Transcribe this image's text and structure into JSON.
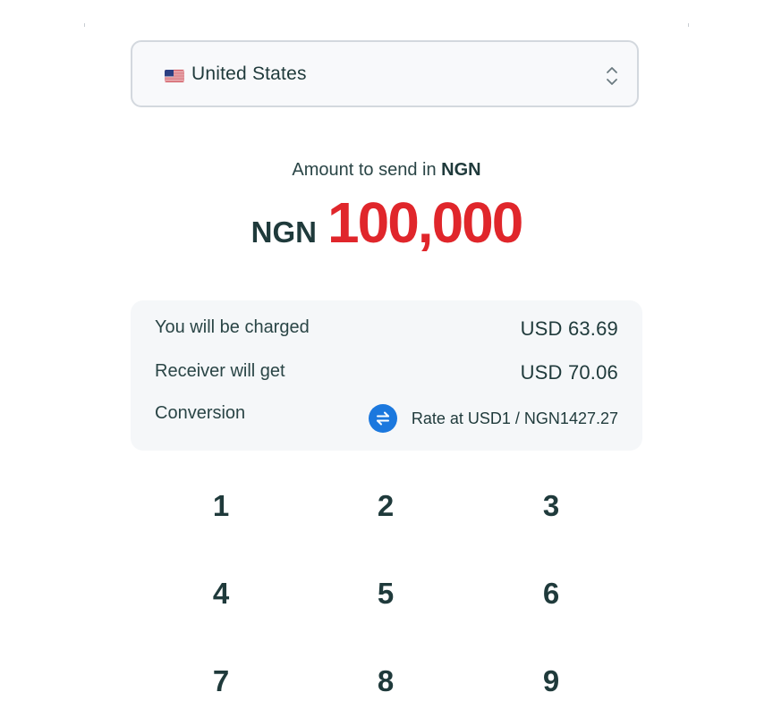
{
  "country_select": {
    "flag_icon": "us-flag-icon",
    "label": "United States",
    "chevron_icon": "updown-chevron-icon"
  },
  "amount": {
    "caption_prefix": "Amount to send in ",
    "caption_currency": "NGN",
    "currency": "NGN",
    "value": "100,000",
    "value_color": "#e0262b"
  },
  "summary": {
    "charged_label": "You will be charged",
    "charged_value": "USD 63.69",
    "receiver_label": "Receiver will get",
    "receiver_value": "USD 70.06",
    "conversion_label": "Conversion",
    "rate_text": "Rate at USD1 / NGN1427.27",
    "swap_icon": "swap-arrows-icon",
    "accent_color": "#1b78de"
  },
  "keypad": {
    "keys": [
      "1",
      "2",
      "3",
      "4",
      "5",
      "6",
      "7",
      "8",
      "9"
    ]
  }
}
